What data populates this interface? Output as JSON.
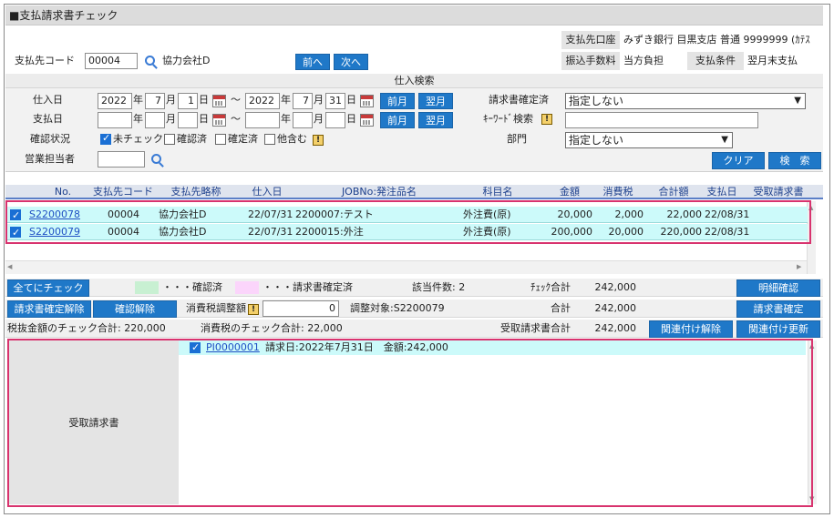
{
  "window": {
    "title": "■支払請求書チェック"
  },
  "header": {
    "payee_code_label": "支払先コード",
    "payee_code_value": "00004",
    "payee_name": "協力会社D",
    "prev_label": "前へ",
    "next_label": "次へ",
    "account_label": "支払先口座",
    "account_value": "みずき銀行 目黒支店 普通 9999999 (ｶﾃｽ",
    "fee_label": "振込手数料",
    "fee_value": "当方負担",
    "terms_label": "支払条件",
    "terms_value": "翌月末支払"
  },
  "search": {
    "section_title": "仕入検索",
    "purchase_date_label": "仕入日",
    "purchase_from": {
      "year": "2022",
      "month": "7",
      "day": "1"
    },
    "purchase_to": {
      "year": "2022",
      "month": "7",
      "day": "31"
    },
    "year_unit": "年",
    "month_unit": "月",
    "day_unit": "日",
    "tilde": "～",
    "prev_month_label": "前月",
    "next_month_label": "翌月",
    "pay_date_label": "支払日",
    "check_status_label": "確認状況",
    "status_unchecked": "未チェック",
    "status_confirmed": "確認済",
    "status_finalized": "確定済",
    "status_others": "他含む",
    "sales_rep_label": "営業担当者",
    "invoice_final_label": "請求書確定済",
    "invoice_final_value": "指定しない",
    "keyword_label": "ｷｰﾜｰﾄﾞ検索",
    "dept_label": "部門",
    "dept_value": "指定しない",
    "clear_label": "クリア",
    "search_label": "検　索"
  },
  "table": {
    "columns": [
      "No.",
      "支払先コード",
      "支払先略称",
      "仕入日",
      "JOBNo:発注品名",
      "科目名",
      "金額",
      "消費税",
      "合計額",
      "支払日",
      "受取請求書"
    ],
    "rows": [
      {
        "no": "S2200078",
        "code": "00004",
        "name": "協力会社D",
        "date": "22/07/31",
        "job": "2200007:テスト",
        "account": "外注費(原)",
        "amount": "20,000",
        "tax": "2,000",
        "total": "22,000",
        "pay_date": "22/08/31"
      },
      {
        "no": "S2200079",
        "code": "00004",
        "name": "協力会社D",
        "date": "22/07/31",
        "job": "2200015:外注",
        "account": "外注費(原)",
        "amount": "200,000",
        "tax": "20,000",
        "total": "220,000",
        "pay_date": "22/08/31"
      }
    ]
  },
  "summary": {
    "check_all_label": "全てにチェック",
    "legend_confirmed": "・・・確認済",
    "legend_finalized": "・・・請求書確定済",
    "count_label": "該当件数: 2",
    "check_total_label": "ﾁｪｯｸ合計",
    "check_total_value": "242,000",
    "detail_confirm_label": "明細確認",
    "cancel_invoice_final_label": "請求書確定解除",
    "cancel_confirm_label": "確認解除",
    "tax_adjust_label": "消費税調整額",
    "tax_adjust_value": "0",
    "adjust_target": "調整対象:S2200079",
    "total_label": "合計",
    "total_value": "242,000",
    "invoice_finalize_label": "請求書確定",
    "pretax_total": "税抜金額のチェック合計: 220,000",
    "tax_total": "消費税のチェック合計: 22,000",
    "received_total_label": "受取請求書合計",
    "received_total_value": "242,000",
    "unlink_label": "関連付け解除",
    "update_link_label": "関連付け更新"
  },
  "received": {
    "panel_label": "受取請求書",
    "item_id": "PI0000001",
    "item_text": "請求日:2022年7月31日　金額:242,000"
  },
  "colors": {
    "accent": "#1f78c8",
    "row_bg": "#ccfafa",
    "highlight": "#d8336e",
    "confirmed": "#c8f0d2",
    "finalized": "#fbd5fb"
  }
}
